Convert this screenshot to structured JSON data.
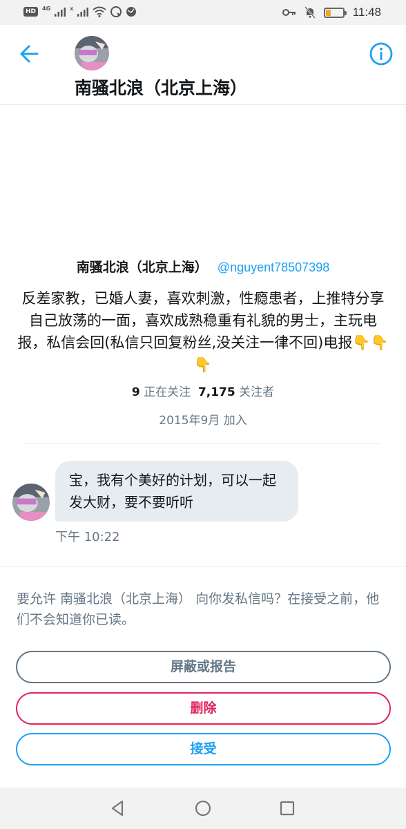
{
  "status_bar": {
    "hd": "HD",
    "network": "4G",
    "network_x": "x",
    "time": "11:48",
    "battery_level": 0.25
  },
  "header": {
    "title": "南骚北浪（北京上海）"
  },
  "profile": {
    "name": "南骚北浪（北京上海）",
    "handle": "@nguyent78507398",
    "bio": "反差家教，已婚人妻，喜欢刺激，性瘾患者，上推特分享自己放荡的一面，喜欢成熟稳重有礼貌的男士，主玩电报，私信会回(私信只回复粉丝,没关注一律不回)电报👇👇👇",
    "following_count": "9",
    "following_label": "正在关注",
    "followers_count": "7,175",
    "followers_label": "关注者",
    "joined": "2015年9月 加入"
  },
  "message": {
    "text": "宝，我有个美好的计划，可以一起发大财，要不要听听",
    "time": "下午 10:22"
  },
  "request": {
    "prompt": "要允许 南骚北浪（北京上海） 向你发私信吗？在接受之前，他们不会知道你已读。",
    "block_label": "屏蔽或报告",
    "delete_label": "删除",
    "accept_label": "接受"
  },
  "colors": {
    "twitter_blue": "#1da1f2",
    "delete_red": "#e0245e",
    "muted_gray": "#657786",
    "bubble_bg": "#e6ecf0"
  },
  "icons": [
    "back-arrow-icon",
    "info-icon",
    "triangle-back-icon",
    "circle-home-icon",
    "square-recents-icon",
    "key-icon",
    "mute-bell-icon",
    "wifi-icon",
    "signal-icon"
  ]
}
